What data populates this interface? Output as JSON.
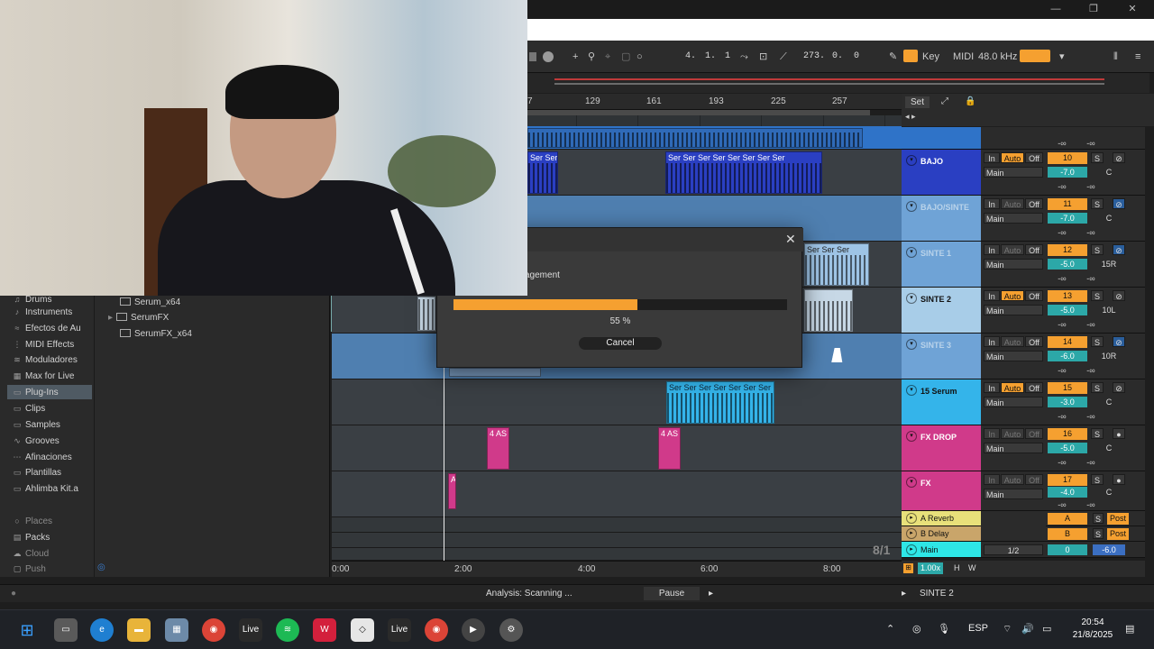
{
  "window": {
    "minimize_glyph": "—",
    "maximize_glyph": "❐",
    "close_glyph": "✕"
  },
  "transport": {
    "position_bars": "4.",
    "position_beats": "1.",
    "position_sixteenths": "1",
    "end_bars": "273.",
    "end_beats": "0.",
    "end_sixteenths": "0",
    "key_label": "Key",
    "midi_label": "MIDI",
    "sample_rate": "48.0 kHz"
  },
  "ruler": {
    "bars": [
      "7",
      "129",
      "161",
      "193",
      "225",
      "257"
    ]
  },
  "set_button": "Set",
  "tracks": [
    {
      "name": "",
      "color": "#2f73c8",
      "clips": []
    },
    {
      "name": "BAJO",
      "number": "10",
      "volume": "-7.0",
      "pan": "C",
      "color": "#2a3fc2",
      "io": "Main",
      "clips": [
        {
          "label": "Ser Ser"
        },
        {
          "label": "Ser Ser Ser Ser Ser Ser Ser Ser"
        }
      ]
    },
    {
      "name": "BAJO/SINTE",
      "number": "11",
      "volume": "-7.0",
      "pan": "C",
      "color": "#6fa3d6",
      "io": "Main",
      "clips": []
    },
    {
      "name": "SINTE 1",
      "number": "12",
      "volume": "-5.0",
      "pan": "15R",
      "color": "#6fa3d6",
      "io": "Main",
      "clips": [
        {
          "label": "Ser Ser Ser"
        }
      ]
    },
    {
      "name": "SINTE 2",
      "number": "13",
      "volume": "-5.0",
      "pan": "10L",
      "color": "#a8cde8",
      "io": "Main",
      "clips": []
    },
    {
      "name": "SINTE 3",
      "number": "14",
      "volume": "-6.0",
      "pan": "10R",
      "color": "#6fa3d6",
      "io": "Main",
      "clips": []
    },
    {
      "name": "15 Serum",
      "number": "15",
      "volume": "-3.0",
      "pan": "C",
      "color": "#34b4ea",
      "io": "Main",
      "clips": [
        {
          "label": "Ser Ser Ser Ser Ser Ser Ser"
        }
      ]
    },
    {
      "name": "FX DROP",
      "number": "16",
      "volume": "-5.0",
      "pan": "C",
      "color": "#d03a8a",
      "io": "Main",
      "clips": [
        {
          "label": "4 AS"
        },
        {
          "label": "4 AS"
        }
      ]
    },
    {
      "name": "FX",
      "number": "17",
      "volume": "-4.0",
      "pan": "C",
      "color": "#d03a8a",
      "io": "Main",
      "clips": [
        {
          "label": "A"
        }
      ]
    }
  ],
  "returns": [
    {
      "name": "A Reverb",
      "send": "A",
      "post": "Post",
      "color": "#e8e07a"
    },
    {
      "name": "B Delay",
      "send": "B",
      "post": "Post",
      "color": "#c9a56a"
    }
  ],
  "main_track": {
    "name": "Main",
    "io": "1/2",
    "volume": "0",
    "pan": "-6.0",
    "color": "#2ee6e6"
  },
  "mixer_labels": {
    "in": "In",
    "auto": "Auto",
    "off": "Off",
    "solo": "S",
    "minus_inf": "-∞"
  },
  "extras": {
    "time_sig": "8/1",
    "zoom": "1.00x",
    "h": "H",
    "w": "W"
  },
  "browser": {
    "categories": [
      {
        "label": "Drums",
        "icon": "♫"
      },
      {
        "label": "Instruments",
        "icon": "♪"
      },
      {
        "label": "Efectos de Au",
        "icon": "≈"
      },
      {
        "label": "MIDI Effects",
        "icon": "⋮"
      },
      {
        "label": "Moduladores",
        "icon": "≋"
      },
      {
        "label": "Max for Live",
        "icon": "▦"
      },
      {
        "label": "Plug-Ins",
        "icon": "▭"
      },
      {
        "label": "Clips",
        "icon": "▭"
      },
      {
        "label": "Samples",
        "icon": "▭"
      },
      {
        "label": "Grooves",
        "icon": "∿"
      },
      {
        "label": "Afinaciones",
        "icon": "⋯"
      },
      {
        "label": "Plantillas",
        "icon": "▭"
      },
      {
        "label": "Ahlimba Kit.a",
        "icon": "▭"
      }
    ],
    "places_header": "Places",
    "places": [
      "Packs",
      "Cloud",
      "Push"
    ],
    "files": [
      "Serum_x64",
      "SerumFX",
      "SerumFX_x64"
    ]
  },
  "timeline": {
    "marks": [
      "0:00",
      "2:00",
      "4:00",
      "6:00",
      "8:00"
    ]
  },
  "status": {
    "analysis": "Analysis: Scanning ...",
    "pause": "Pause",
    "selected_track": "SINTE 2"
  },
  "dialog": {
    "subtitle": "agement",
    "progress_percent": 55,
    "progress_label": "55 %",
    "cancel": "Cancel"
  },
  "taskbar": {
    "apps": [
      "Live",
      "Live"
    ],
    "lang": "ESP",
    "time": "20:54",
    "date": "21/8/2025"
  },
  "colors": {
    "accent": "#f5a030",
    "teal": "#2ca8a8"
  }
}
